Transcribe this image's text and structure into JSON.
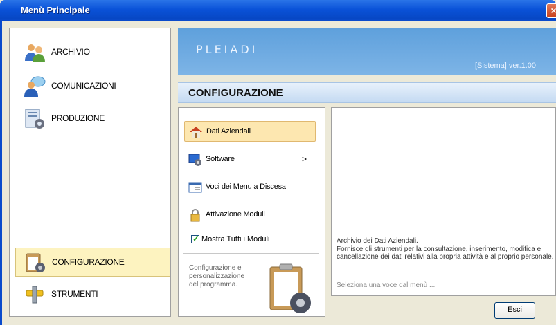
{
  "window": {
    "title": "Menù Principale",
    "close_label": "×"
  },
  "sidebar": {
    "items": [
      {
        "label": "ARCHIVIO",
        "icon": "users-icon"
      },
      {
        "label": "COMUNICAZIONI",
        "icon": "chat-user-icon"
      },
      {
        "label": "PRODUZIONE",
        "icon": "document-gear-icon"
      },
      {
        "label": "CONFIGURAZIONE",
        "icon": "clipboard-gear-icon",
        "selected": true
      },
      {
        "label": "STRUMENTI",
        "icon": "tools-icon"
      }
    ]
  },
  "banner": {
    "logo": "PLEIADI",
    "version": "[Sistema]  ver.1.00"
  },
  "section": {
    "title": "CONFIGURAZIONE"
  },
  "menu": {
    "items": [
      {
        "label": "Dati Aziendali",
        "icon": "house-icon",
        "selected": true
      },
      {
        "label": "Software",
        "icon": "monitor-gear-icon",
        "submenu": ">"
      },
      {
        "label": "Voci dei Menu a Discesa",
        "icon": "window-list-icon"
      },
      {
        "label": "Attivazione Moduli",
        "icon": "lock-icon"
      }
    ],
    "show_all_label": "Mostra Tutti i Moduli",
    "show_all_checked": true,
    "description": [
      "Configurazione e",
      "personalizzazione",
      "del programma."
    ]
  },
  "details": {
    "title": "Archivio dei Dati Aziendali.",
    "body": "Fornisce gli strumenti per la consultazione, inserimento, modifica e cancellazione dei dati relativi alla propria attività e al proprio personale.",
    "hint": "Seleziona una voce dal menù ..."
  },
  "footer": {
    "exit_label_first": "E",
    "exit_label_rest": "sci"
  },
  "colors": {
    "titlebar": "#0a52d8",
    "selected_nav": "#fdf3c0",
    "banner": "#6aa8e0"
  }
}
